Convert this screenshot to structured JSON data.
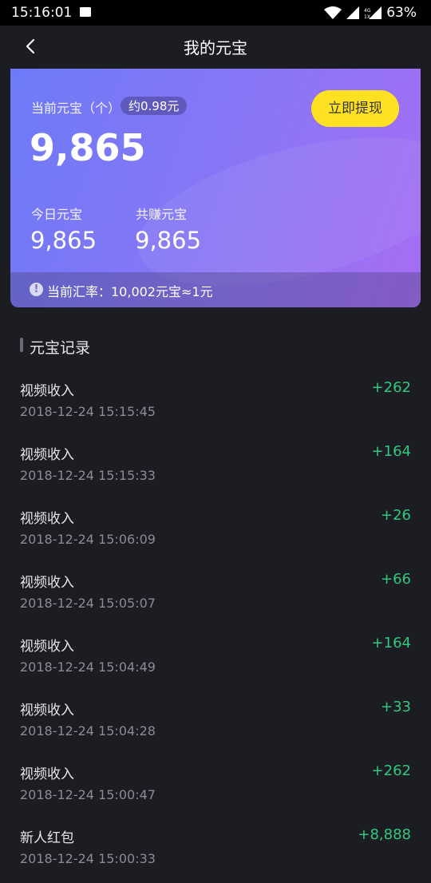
{
  "status_bar": {
    "time": "15:16:01",
    "battery": "63%"
  },
  "header": {
    "title": "我的元宝"
  },
  "card": {
    "current_label": "当前元宝（个）",
    "approx_value": "约0.98元",
    "current_amount": "9,865",
    "withdraw_label": "立即提现",
    "today_label": "今日元宝",
    "today_amount": "9,865",
    "total_label": "共赚元宝",
    "total_amount": "9,865",
    "rate_text": "当前汇率：10,002元宝≈1元"
  },
  "records_section": {
    "title": "元宝记录"
  },
  "records": [
    {
      "name": "视频收入",
      "time": "2018-12-24 15:15:45",
      "amount": "+262"
    },
    {
      "name": "视频收入",
      "time": "2018-12-24 15:15:33",
      "amount": "+164"
    },
    {
      "name": "视频收入",
      "time": "2018-12-24 15:06:09",
      "amount": "+26"
    },
    {
      "name": "视频收入",
      "time": "2018-12-24 15:05:07",
      "amount": "+66"
    },
    {
      "name": "视频收入",
      "time": "2018-12-24 15:04:49",
      "amount": "+164"
    },
    {
      "name": "视频收入",
      "time": "2018-12-24 15:04:28",
      "amount": "+33"
    },
    {
      "name": "视频收入",
      "time": "2018-12-24 15:00:47",
      "amount": "+262"
    },
    {
      "name": "新人红包",
      "time": "2018-12-24 15:00:33",
      "amount": "+8,888"
    }
  ],
  "colors": {
    "accent_yellow": "#ffe123",
    "income_green": "#32c77e",
    "background": "#1c1d23"
  }
}
